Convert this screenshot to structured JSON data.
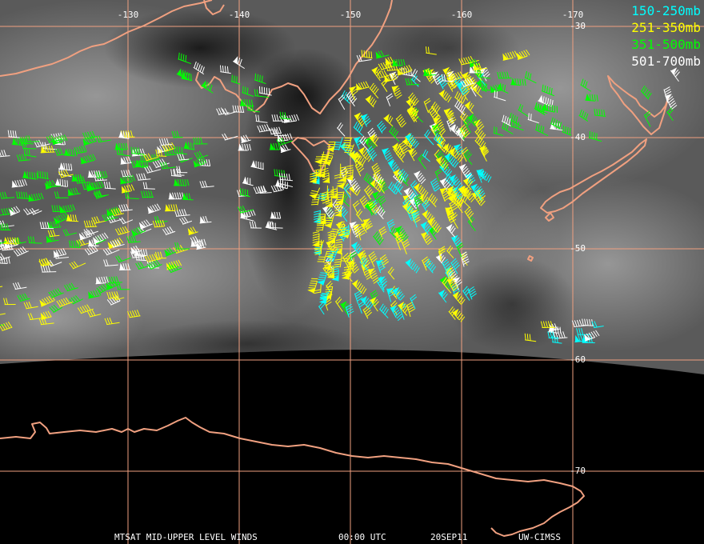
{
  "map": {
    "longitude_labels": [
      "-130",
      "-140",
      "-150",
      "-160",
      "-170"
    ],
    "latitude_labels": [
      "-30",
      "-40",
      "-50",
      "-60",
      "-70"
    ],
    "grid_color": "#f0a080",
    "coast_color": "#f0a080",
    "legend": [
      {
        "label": "150-250mb",
        "color": "#00ffff"
      },
      {
        "label": "251-350mb",
        "color": "#ffff00"
      },
      {
        "label": "351-500mb",
        "color": "#00ff00"
      },
      {
        "label": "501-700mb",
        "color": "#ffffff"
      }
    ],
    "footer": {
      "product": "MTSAT MID-UPPER LEVEL WINDS",
      "time": "00:00 UTC",
      "date": "20SEP11",
      "source": "UW-CIMSS"
    }
  }
}
